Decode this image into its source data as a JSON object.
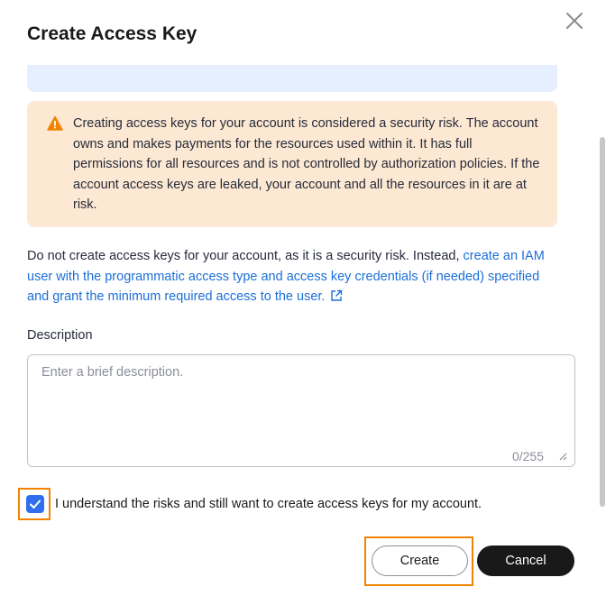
{
  "dialog": {
    "title": "Create Access Key",
    "close_icon": "close-icon"
  },
  "warning": {
    "icon": "warning-triangle-icon",
    "text": "Creating access keys for your account is considered a security risk. The account owns and makes payments for the resources used within it. It has full permissions for all resources and is not controlled by authorization policies. If the account access keys are leaked, your account and all the resources in it are at risk."
  },
  "notice": {
    "text": "Do not create access keys for your account, as it is a security risk. Instead, ",
    "link": "create an IAM user with the programmatic access type and access key credentials (if needed) specified and grant the minimum required access to the user.",
    "link_icon": "external-link-icon"
  },
  "description": {
    "label": "Description",
    "placeholder": "Enter a brief description.",
    "value": "",
    "counter": "0/255"
  },
  "agreement": {
    "checked": true,
    "label": "I understand the risks and still want to create access keys for my account."
  },
  "actions": {
    "create_label": "Create",
    "cancel_label": "Cancel"
  },
  "colors": {
    "warning_bg": "#fde9d3",
    "warning_icon": "#f08300",
    "link": "#1b6fd8",
    "checkbox": "#2f6fed",
    "highlight": "#f08300",
    "primary_dark": "#191919"
  }
}
